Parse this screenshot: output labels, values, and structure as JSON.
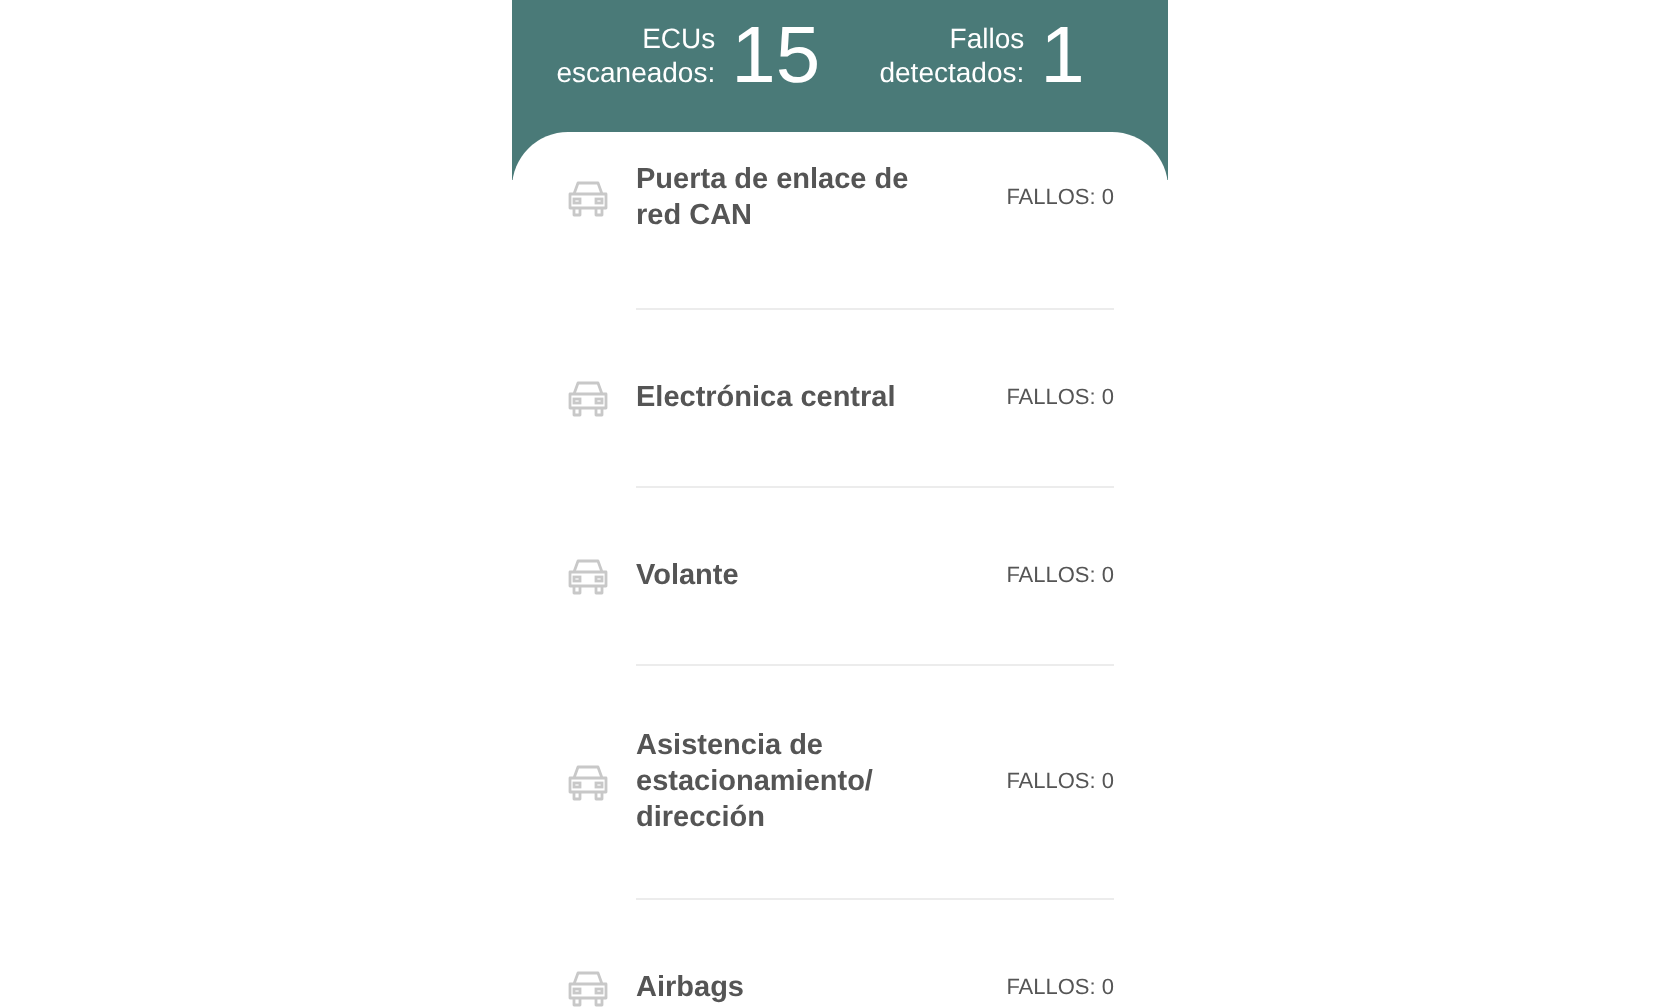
{
  "summary": [
    {
      "label": "ECUs escaneados:",
      "value": "15"
    },
    {
      "label": "Fallos detectados:",
      "value": "1"
    }
  ],
  "ecus": [
    {
      "name": "Puerta de enlace de red CAN",
      "faults": "FALLOS: 0"
    },
    {
      "name": "Electrónica central",
      "faults": "FALLOS: 0"
    },
    {
      "name": "Volante",
      "faults": "FALLOS: 0"
    },
    {
      "name": "Asistencia de estacionamiento/ dirección",
      "faults": "FALLOS: 0"
    },
    {
      "name": "Airbags",
      "faults": "FALLOS: 0"
    }
  ]
}
